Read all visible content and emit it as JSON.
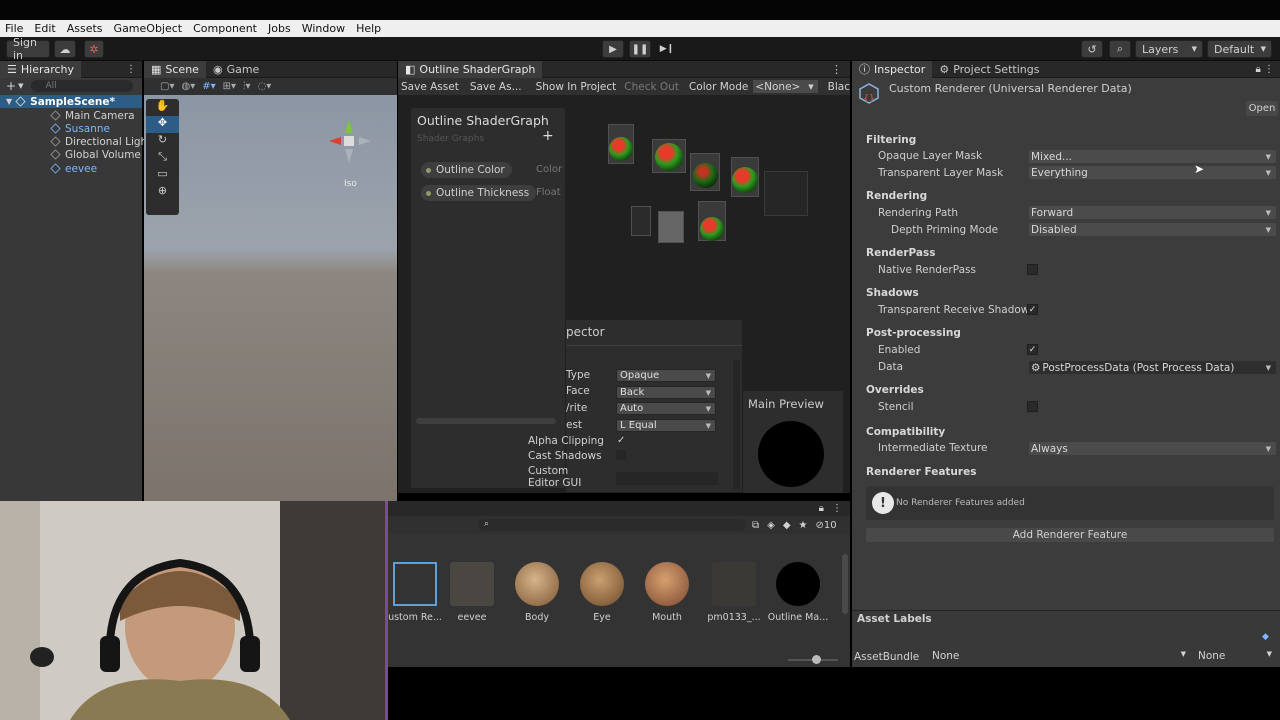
{
  "menu": [
    "File",
    "Edit",
    "Assets",
    "GameObject",
    "Component",
    "Jobs",
    "Window",
    "Help"
  ],
  "toolbar": {
    "sign_in": "Sign in",
    "layers": "Layers",
    "layout": "Default"
  },
  "hierarchy": {
    "tab": "Hierarchy",
    "search_placeholder": "All",
    "scene": "SampleScene*",
    "items": [
      "Main Camera",
      "Susanne",
      "Directional Ligh",
      "Global Volume",
      "eevee"
    ]
  },
  "scene": {
    "tab_scene": "Scene",
    "tab_game": "Game",
    "iso": "Iso"
  },
  "shader_graph": {
    "tab": "Outline ShaderGraph",
    "toolbar": {
      "save_asset": "Save Asset",
      "save_as": "Save As...",
      "show_in_project": "Show In Project",
      "check_out": "Check Out",
      "color_mode_label": "Color Mode",
      "color_mode_value": "<None>",
      "black": "Blac"
    },
    "blackboard": {
      "title": "Outline ShaderGraph",
      "subtitle": "Shader Graphs",
      "add": "+",
      "properties": [
        {
          "name": "Outline Color",
          "type": "Color"
        },
        {
          "name": "Outline Thickness",
          "type": "Float"
        }
      ]
    },
    "graph_inspector": {
      "title": "pector",
      "rows": [
        {
          "label": "Type",
          "value": "Opaque"
        },
        {
          "label": "Face",
          "value": "Back"
        },
        {
          "label": "/rite",
          "value": "Auto"
        },
        {
          "label": "est",
          "value": "L Equal"
        }
      ],
      "alpha_clipping": "Alpha Clipping",
      "cast_shadows": "Cast Shadows",
      "custom_editor": "Custom Editor GUI"
    },
    "main_preview": "Main Preview"
  },
  "inspector": {
    "tab_inspector": "Inspector",
    "tab_project_settings": "Project Settings",
    "asset_title": "Custom Renderer (Universal Renderer Data)",
    "open_button": "Open",
    "filtering": "Filtering",
    "opaque_layer_mask": "Opaque Layer Mask",
    "opaque_layer_mask_value": "Mixed...",
    "transparent_layer_mask": "Transparent Layer Mask",
    "transparent_layer_mask_value": "Everything",
    "rendering": "Rendering",
    "rendering_path": "Rendering Path",
    "rendering_path_value": "Forward",
    "depth_priming_mode": "Depth Priming Mode",
    "depth_priming_mode_value": "Disabled",
    "renderpass": "RenderPass",
    "native_renderpass": "Native RenderPass",
    "shadows": "Shadows",
    "transparent_receive_shadows": "Transparent Receive Shadows",
    "post_processing": "Post-processing",
    "enabled": "Enabled",
    "data": "Data",
    "data_value": "PostProcessData (Post Process Data)",
    "overrides": "Overrides",
    "stencil": "Stencil",
    "compatibility": "Compatibility",
    "intermediate_texture": "Intermediate Texture",
    "intermediate_texture_value": "Always",
    "renderer_features": "Renderer Features",
    "no_features": "No Renderer Features added",
    "add_feature": "Add Renderer Feature",
    "asset_labels": "Asset Labels",
    "asset_bundle": "AssetBundle",
    "asset_bundle_value": "None",
    "asset_bundle_variant": "None",
    "checkmark": "✓"
  },
  "project": {
    "hidden_count": "10",
    "assets": [
      "ustom Re...",
      "eevee",
      "Body",
      "Eye",
      "Mouth",
      "pm0133_...",
      "Outline Ma..."
    ]
  }
}
